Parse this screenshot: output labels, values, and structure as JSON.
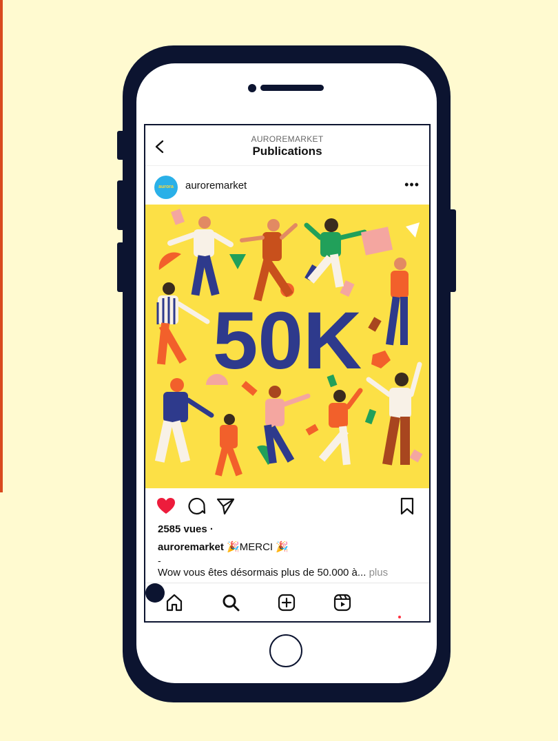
{
  "header": {
    "account_caption": "AUROREMARKET",
    "title": "Publications"
  },
  "post": {
    "username": "auroremarket",
    "avatar_text": "aurora",
    "image_text": "50K",
    "views": "2585 vues ·",
    "caption_user": "auroremarket",
    "caption_text": "🎉MERCI 🎉",
    "caption_separator": "-",
    "caption_line2": "Wow vous êtes désormais plus de 50.000 à...",
    "more_label": "plus",
    "liked": true
  },
  "icons": {
    "back": "chevron-left-icon",
    "more": "more-horizontal-icon",
    "like": "heart-icon",
    "comment": "comment-icon",
    "share": "paper-plane-icon",
    "save": "bookmark-icon",
    "nav": [
      "home-icon",
      "search-icon",
      "add-post-icon",
      "reels-icon",
      "profile-icon"
    ]
  },
  "colors": {
    "background": "#fffad0",
    "phone": "#0c1430",
    "post_background": "#fce046",
    "heart": "#ed1c3c",
    "text_blue": "#2e3a8c",
    "notification_dot": "#ff3040"
  }
}
